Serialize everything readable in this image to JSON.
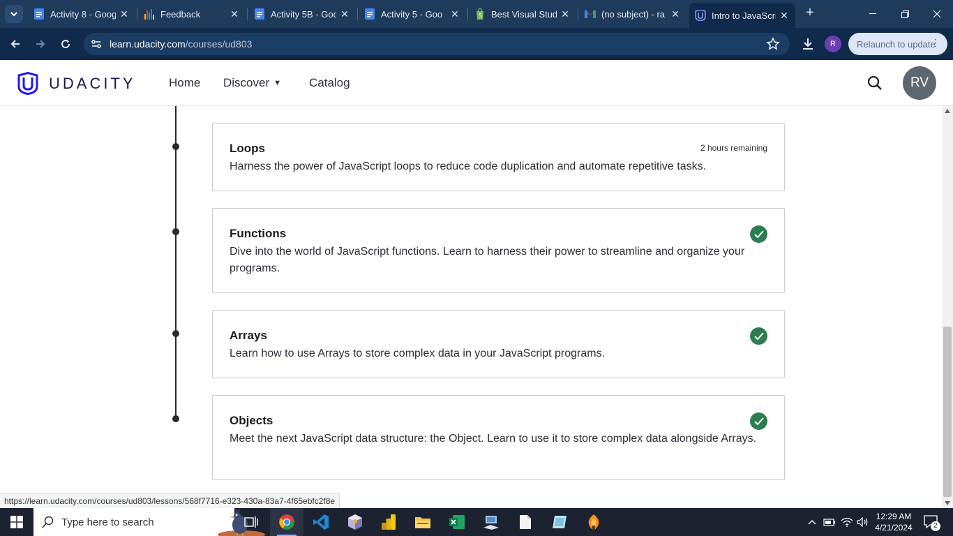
{
  "browser": {
    "tabs": [
      {
        "title": "Activity 8 - Goog",
        "icon": "google-docs-icon"
      },
      {
        "title": "Feedback",
        "icon": "feedback-chart-icon"
      },
      {
        "title": "Activity 5B - Goo",
        "icon": "google-docs-icon"
      },
      {
        "title": "Activity 5 - Goo",
        "icon": "google-docs-icon"
      },
      {
        "title": "Best Visual Studi",
        "icon": "shopify-icon"
      },
      {
        "title": "(no subject) - ra",
        "icon": "gmail-icon"
      },
      {
        "title": "Intro to JavaScrip",
        "icon": "udacity-icon",
        "active": true
      }
    ],
    "address": {
      "host": "learn.udacity.com",
      "path": "/courses/ud803"
    },
    "profile_initial": "R",
    "relaunch_label": "Relaunch to update",
    "status_url": "https://learn.udacity.com/courses/ud803/lessons/568f7716-e323-430a-83a7-4f65ebfc2f8e"
  },
  "header": {
    "brand": "UDACITY",
    "nav": {
      "home": "Home",
      "discover": "Discover",
      "catalog": "Catalog"
    },
    "avatar_initials": "RV"
  },
  "lessons": [
    {
      "title": "Loops",
      "description": "Harness the power of JavaScript loops to reduce code duplication and automate repetitive tasks.",
      "remaining": "2 hours remaining",
      "completed": false
    },
    {
      "title": "Functions",
      "description": "Dive into the world of JavaScript functions. Learn to harness their power to streamline and organize your programs.",
      "completed": true
    },
    {
      "title": "Arrays",
      "description": "Learn how to use Arrays to store complex data in your JavaScript programs.",
      "completed": true
    },
    {
      "title": "Objects",
      "description": "Meet the next JavaScript data structure: the Object. Learn to use it to store complex data alongside Arrays.",
      "completed": true
    }
  ],
  "taskbar": {
    "search_placeholder": "Type here to search",
    "apps": [
      "task-view-icon",
      "chrome-icon",
      "vscode-icon",
      "cube-app-icon",
      "power-bi-icon",
      "file-explorer-icon",
      "excel-icon",
      "network-app-icon",
      "notepad-icon",
      "paint-icon",
      "fl-studio-icon"
    ],
    "time": "12:29 AM",
    "date": "4/21/2024",
    "notification_count": "2"
  },
  "colors": {
    "tabstrip": "#1f3b5c",
    "toolbar": "#0f2a4a",
    "brand": "#171a53",
    "brand_logo": "#2015ff",
    "check": "#2e7d4f",
    "avatar": "#5c6770"
  }
}
